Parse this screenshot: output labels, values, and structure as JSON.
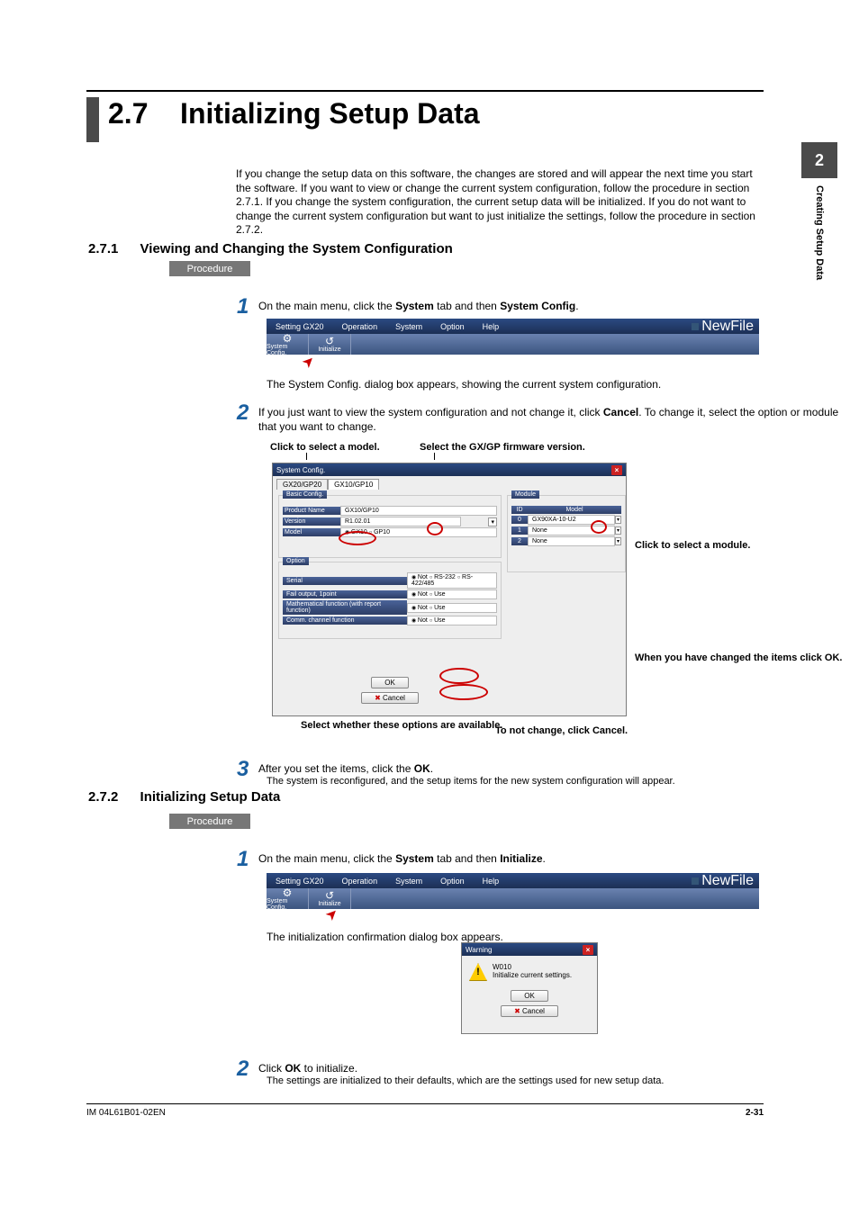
{
  "side_tab": {
    "number": "2",
    "text": "Creating Setup Data"
  },
  "section": {
    "number": "2.7",
    "title": "Initializing Setup Data"
  },
  "intro": "If you change the setup data on this software, the changes are stored and will appear the next time you start the software. If you want to view or change the current system configuration, follow the procedure in section 2.7.1. If you change the system configuration, the current setup data will be initialized. If you do not want to change the current system configuration but want to just initialize the settings, follow the procedure in section 2.7.2.",
  "sub271": {
    "num": "2.7.1",
    "title": "Viewing and Changing the System Configuration"
  },
  "sub272": {
    "num": "2.7.2",
    "title": "Initializing Setup Data"
  },
  "procedure": "Procedure",
  "steps_a": {
    "s1_pre": "On the main menu, click the ",
    "s1_b1": "System",
    "s1_mid": " tab and then ",
    "s1_b2": "System Config",
    "s1_post": ".",
    "s1_result": "The System Config. dialog box appears, showing the current system configuration.",
    "s2_pre": "If you just want to view the system configuration and not change it, click ",
    "s2_b": "Cancel",
    "s2_post": ". To change it, select the option or module that you want to change.",
    "s3_pre": "After you set the items, click the ",
    "s3_b": "OK",
    "s3_post": ".",
    "s3_result": "The system is reconfigured, and the setup items for the new system configuration will appear."
  },
  "callouts": {
    "c1": "Click to select a model.",
    "c2": "Select the GX/GP firmware version.",
    "c3": "Click to select a module.",
    "c4": "When you have changed the items click OK.",
    "c5": "Select whether these options are available.",
    "c6": "To not change, click Cancel."
  },
  "steps_b": {
    "s1_pre": "On the main menu, click the ",
    "s1_b1": "System",
    "s1_mid": " tab and then ",
    "s1_b2": "Initialize",
    "s1_post": ".",
    "s1_result": "The initialization confirmation dialog box appears.",
    "s2_pre": "Click ",
    "s2_b": "OK",
    "s2_post": " to initialize.",
    "s2_result": "The settings are initialized to their defaults, which are the settings used for new setup data."
  },
  "menubar": {
    "items": [
      "Setting GX20",
      "Operation",
      "System",
      "Option",
      "Help"
    ],
    "right": "NewFile",
    "btn1": "System Config.",
    "btn2": "Initialize"
  },
  "syscfg": {
    "title": "System Config.",
    "tab1": "GX20/GP20",
    "tab2": "GX10/GP10",
    "basic": "Basic Config.",
    "product_name_l": "Product Name",
    "product_name_v": "GX10/GP10",
    "version_l": "Version",
    "version_v": "R1.02.01",
    "model_l": "Model",
    "model_r1": "GX10",
    "model_r2": "GP10",
    "module": "Module",
    "id": "ID",
    "model_h": "Model",
    "m0": "GX90XA-10-U2",
    "m1": "None",
    "m2": "None",
    "option": "Option",
    "serial_l": "Serial",
    "serial_r1": "Not",
    "serial_r2": "RS-232",
    "serial_r3": "RS-422/485",
    "fail_l": "Fail output, 1point",
    "fail_r1": "Not",
    "fail_r2": "Use",
    "math_l": "Mathematical function (with report function)",
    "math_r1": "Not",
    "math_r2": "Use",
    "comm_l": "Comm. channel function",
    "comm_r1": "Not",
    "comm_r2": "Use",
    "ok": "OK",
    "cancel": "Cancel"
  },
  "warn": {
    "title": "Warning",
    "code": "W010",
    "msg": "Initialize current settings.",
    "ok": "OK",
    "cancel": "Cancel"
  },
  "footer": {
    "doc": "IM 04L61B01-02EN",
    "page": "2-31"
  }
}
